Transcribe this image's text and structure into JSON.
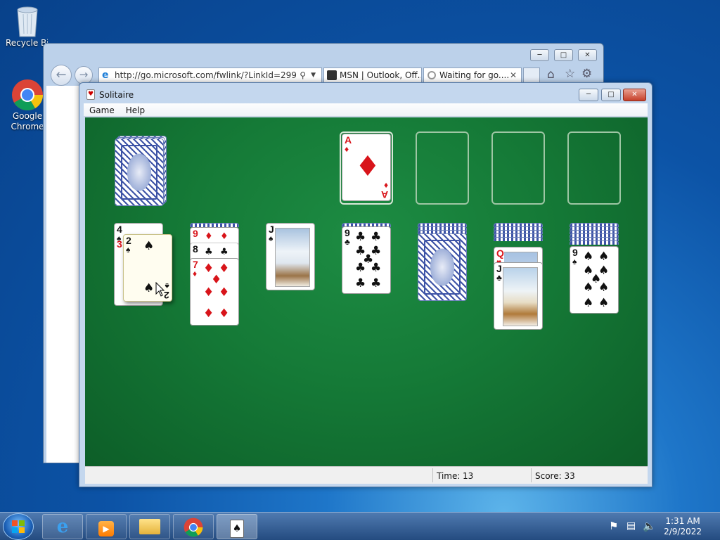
{
  "desktop": {
    "icons": [
      {
        "label": "Recycle Bin"
      },
      {
        "label": "Google Chrome"
      }
    ]
  },
  "ie": {
    "address": "http://go.microsoft.com/fwlink/?LinkId=299",
    "tabs": [
      {
        "label": "MSN | Outlook, Off..."
      },
      {
        "label": "Waiting for go...."
      }
    ]
  },
  "solitaire": {
    "title": "Solitaire",
    "menu": {
      "game": "Game",
      "help": "Help"
    },
    "status": {
      "time_label": "Time:",
      "time_value": "13",
      "score_label": "Score: 33"
    },
    "foundation": [
      {
        "rank": "A",
        "suit": "♦"
      }
    ],
    "tableau": [
      {
        "cards": [
          {
            "rank": "4",
            "suit": "♠"
          },
          {
            "rank": "3",
            "suit": "♥"
          }
        ],
        "dragging": {
          "rank": "2",
          "suit": "♠"
        }
      },
      {
        "cards": [
          {
            "rank": "9",
            "suit": "♦"
          },
          {
            "rank": "8",
            "suit": "♣"
          },
          {
            "rank": "7",
            "suit": "♦"
          }
        ]
      },
      {
        "cards": [
          {
            "rank": "J",
            "suit": "♠"
          }
        ]
      },
      {
        "cards": [
          {
            "rank": "9",
            "suit": "♣"
          }
        ]
      },
      {
        "cards": []
      },
      {
        "cards": [
          {
            "rank": "Q",
            "suit": "♥"
          },
          {
            "rank": "J",
            "suit": "♣"
          }
        ]
      },
      {
        "cards": [
          {
            "rank": "9",
            "suit": "♠"
          }
        ]
      }
    ]
  },
  "taskbar": {
    "clock_time": "1:31 AM",
    "clock_date": "2/9/2022"
  }
}
